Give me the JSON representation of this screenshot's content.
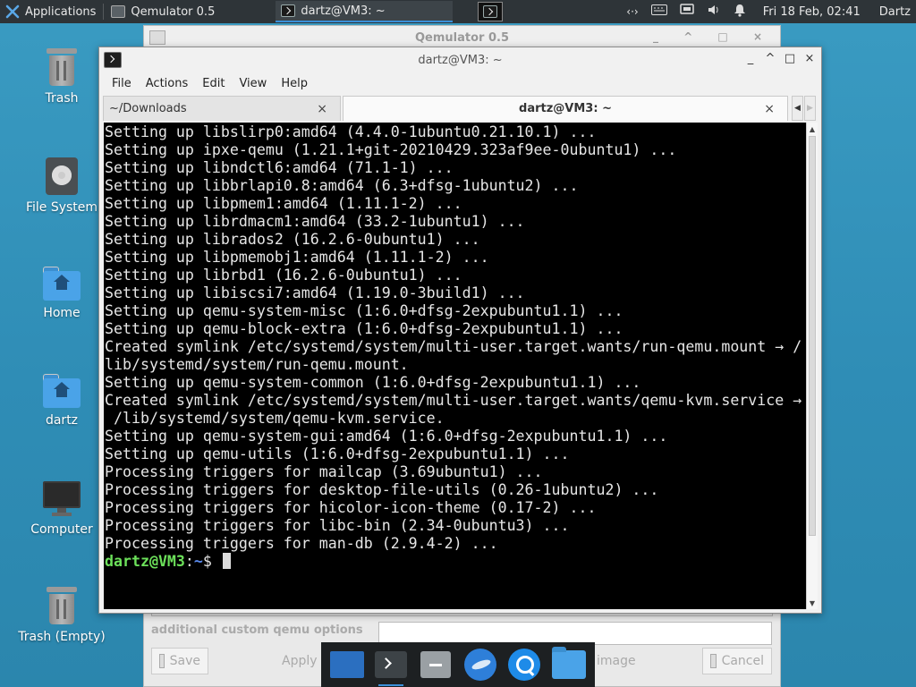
{
  "top_panel": {
    "applications_label": "Applications",
    "tasks": [
      {
        "label": "Qemulator 0.5"
      },
      {
        "label": "dartz@VM3: ~"
      }
    ],
    "datetime": "Fri 18 Feb, 02:41",
    "user": "Dartz"
  },
  "desktop": {
    "icons": [
      {
        "label": "Trash"
      },
      {
        "label": "File System"
      },
      {
        "label": "Home"
      },
      {
        "label": "dartz"
      },
      {
        "label": "Computer"
      },
      {
        "label": "Trash (Empty)"
      }
    ]
  },
  "qemulator": {
    "title": "Qemulator 0.5",
    "custom_options_label": "additional custom qemu options",
    "buttons": {
      "save": "Save",
      "apply": "Apply",
      "image": "image",
      "cancel": "Cancel"
    }
  },
  "terminal": {
    "title": "dartz@VM3: ~",
    "menu": [
      "File",
      "Actions",
      "Edit",
      "View",
      "Help"
    ],
    "tabs": [
      {
        "label": "~/Downloads",
        "close": "×"
      },
      {
        "label": "dartz@VM3: ~",
        "close": "×"
      }
    ],
    "lines": [
      "Setting up libslirp0:amd64 (4.4.0-1ubuntu0.21.10.1) ...",
      "Setting up ipxe-qemu (1.21.1+git-20210429.323af9ee-0ubuntu1) ...",
      "Setting up libndctl6:amd64 (71.1-1) ...",
      "Setting up libbrlapi0.8:amd64 (6.3+dfsg-1ubuntu2) ...",
      "Setting up libpmem1:amd64 (1.11.1-2) ...",
      "Setting up librdmacm1:amd64 (33.2-1ubuntu1) ...",
      "Setting up librados2 (16.2.6-0ubuntu1) ...",
      "Setting up libpmemobj1:amd64 (1.11.1-2) ...",
      "Setting up librbd1 (16.2.6-0ubuntu1) ...",
      "Setting up libiscsi7:amd64 (1.19.0-3build1) ...",
      "Setting up qemu-system-misc (1:6.0+dfsg-2expubuntu1.1) ...",
      "Setting up qemu-block-extra (1:6.0+dfsg-2expubuntu1.1) ...",
      "Created symlink /etc/systemd/system/multi-user.target.wants/run-qemu.mount → /",
      "lib/systemd/system/run-qemu.mount.",
      "Setting up qemu-system-common (1:6.0+dfsg-2expubuntu1.1) ...",
      "Created symlink /etc/systemd/system/multi-user.target.wants/qemu-kvm.service →",
      " /lib/systemd/system/qemu-kvm.service.",
      "Setting up qemu-system-gui:amd64 (1:6.0+dfsg-2expubuntu1.1) ...",
      "Setting up qemu-utils (1:6.0+dfsg-2expubuntu1.1) ...",
      "Processing triggers for mailcap (3.69ubuntu1) ...",
      "Processing triggers for desktop-file-utils (0.26-1ubuntu2) ...",
      "Processing triggers for hicolor-icon-theme (0.17-2) ...",
      "Processing triggers for libc-bin (2.34-0ubuntu3) ...",
      "Processing triggers for man-db (2.9.4-2) ..."
    ],
    "prompt": {
      "user_host": "dartz@VM3",
      "separator": ":",
      "path": "~",
      "symbol": "$ "
    }
  },
  "colors": {
    "prompt_user": "#6ce05a",
    "prompt_path": "#5c8cf0",
    "terminal_bg": "#000000",
    "desktop_bg": "#2f8db6"
  },
  "dock": {
    "items": [
      "show-desktop-icon",
      "terminal-icon",
      "file-manager-icon",
      "web-browser-icon",
      "app-finder-icon",
      "folder-icon"
    ]
  }
}
